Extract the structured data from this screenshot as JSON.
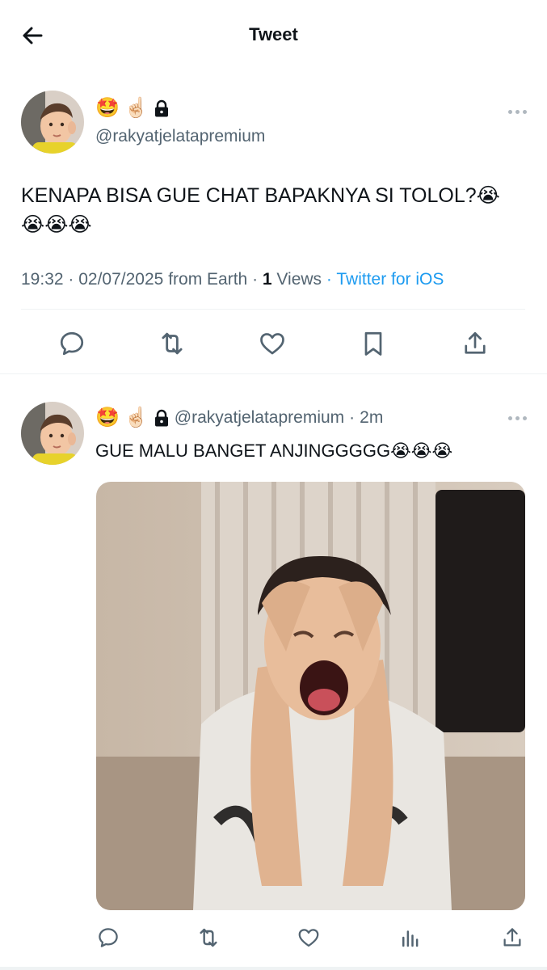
{
  "header": {
    "title": "Tweet",
    "back_icon": "arrow-left-icon"
  },
  "main_tweet": {
    "emoji_badges": [
      "🤩",
      "☝🏻"
    ],
    "locked": true,
    "handle": "@rakyatjelatapremium",
    "text": "KENAPA BISA GUE CHAT BAPAKNYA SI TOLOL?😭😭😭😭",
    "time": "19:32",
    "date": "02/07/2025",
    "location": "from Earth",
    "views_count": "1",
    "views_label": "Views",
    "client": "Twitter for iOS",
    "actions": [
      "reply-icon",
      "retweet-icon",
      "like-icon",
      "bookmark-icon",
      "share-icon"
    ]
  },
  "reply_tweet": {
    "emoji_badges": [
      "🤩",
      "☝🏻"
    ],
    "locked": true,
    "handle": "@rakyatjelatapremium",
    "time_ago": "2m",
    "text": "GUE MALU BANGET ANJINGGGGG😭😭😭",
    "actions": [
      "reply-icon",
      "retweet-icon",
      "like-icon",
      "views-icon",
      "share-icon"
    ]
  },
  "colors": {
    "text": "#0f1419",
    "secondary": "#536471",
    "link": "#1d9bf0",
    "divider": "#eff3f4"
  }
}
